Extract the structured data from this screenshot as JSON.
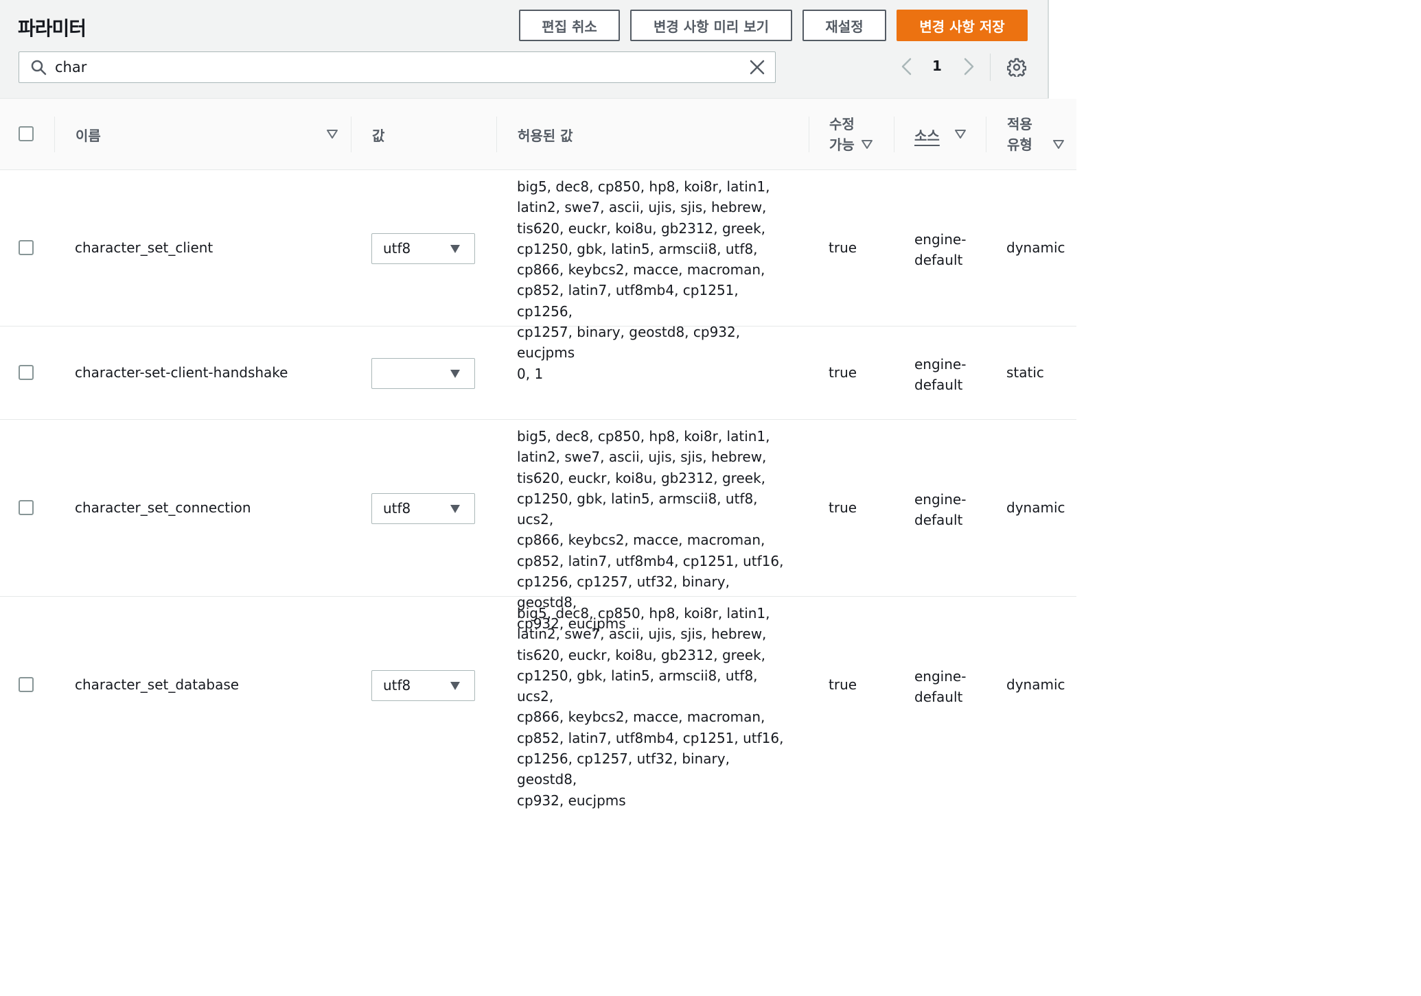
{
  "header": {
    "title": "파라미터",
    "buttons": {
      "cancel_edit": "편집 취소",
      "preview_changes": "변경 사항 미리 보기",
      "reset": "재설정",
      "save_changes": "변경 사항 저장"
    },
    "search": {
      "value": "char",
      "placeholder": ""
    },
    "pagination": {
      "current_page": "1"
    }
  },
  "table": {
    "columns": {
      "name": "이름",
      "value": "값",
      "allowed_values": "허용된 값",
      "modifiable_line1": "수정",
      "modifiable_line2": "가능",
      "source": "소스",
      "apply_type_line1": "적용",
      "apply_type_line2": "유형"
    },
    "rows": [
      {
        "name": "character_set_client",
        "value": "utf8",
        "allowed_lines": [
          "big5, dec8, cp850, hp8, koi8r, latin1,",
          "latin2, swe7, ascii, ujis, sjis, hebrew,",
          "tis620, euckr, koi8u, gb2312, greek,",
          "cp1250, gbk, latin5, armscii8, utf8,",
          "cp866, keybcs2, macce, macroman,",
          "cp852, latin7, utf8mb4, cp1251, cp1256,",
          "cp1257, binary, geostd8, cp932, eucjpms"
        ],
        "modifiable": "true",
        "source_line1": "engine-",
        "source_line2": "default",
        "apply_type": "dynamic"
      },
      {
        "name": "character-set-client-handshake",
        "value": "",
        "allowed_lines": [
          "0, 1"
        ],
        "modifiable": "true",
        "source_line1": "engine-",
        "source_line2": "default",
        "apply_type": "static"
      },
      {
        "name": "character_set_connection",
        "value": "utf8",
        "allowed_lines": [
          "big5, dec8, cp850, hp8, koi8r, latin1,",
          "latin2, swe7, ascii, ujis, sjis, hebrew,",
          "tis620, euckr, koi8u, gb2312, greek,",
          "cp1250, gbk, latin5, armscii8, utf8, ucs2,",
          "cp866, keybcs2, macce, macroman,",
          "cp852, latin7, utf8mb4, cp1251, utf16,",
          "cp1256, cp1257, utf32, binary, geostd8,",
          "cp932, eucjpms"
        ],
        "modifiable": "true",
        "source_line1": "engine-",
        "source_line2": "default",
        "apply_type": "dynamic"
      },
      {
        "name": "character_set_database",
        "value": "utf8",
        "allowed_lines": [
          "big5, dec8, cp850, hp8, koi8r, latin1,",
          "latin2, swe7, ascii, ujis, sjis, hebrew,",
          "tis620, euckr, koi8u, gb2312, greek,",
          "cp1250, gbk, latin5, armscii8, utf8, ucs2,",
          "cp866, keybcs2, macce, macroman,",
          "cp852, latin7, utf8mb4, cp1251, utf16,",
          "cp1256, cp1257, utf32, binary, geostd8,",
          "cp932, eucjpms"
        ],
        "modifiable": "true",
        "source_line1": "engine-",
        "source_line2": "default",
        "apply_type": "dynamic"
      }
    ]
  },
  "colors": {
    "primary": "#ec7211",
    "header_bg": "#f2f3f3",
    "text": "#16191f",
    "secondary_text": "#545b64",
    "border": "#aab7b8"
  }
}
